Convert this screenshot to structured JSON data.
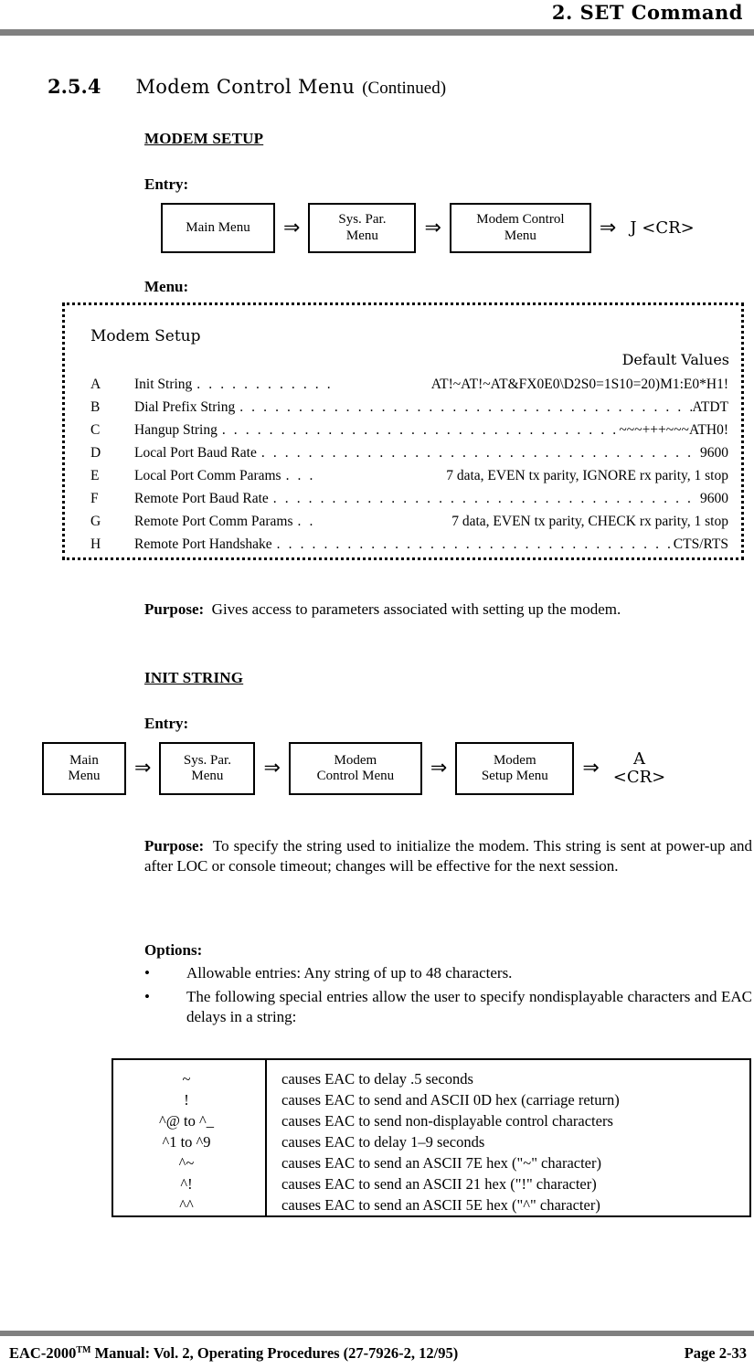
{
  "header": {
    "chapter_title": "2.  SET Command",
    "rule_color": "#808080"
  },
  "section": {
    "number": "2.5.4",
    "title": "Modem Control Menu",
    "continued": "(Continued)"
  },
  "modem_setup": {
    "heading": "MODEM SETUP",
    "entry_label": "Entry:",
    "entry_flow": {
      "boxes": [
        "Main Menu",
        "Sys. Par.\nMenu",
        "Modem Control\nMenu"
      ],
      "arrow": "⇒",
      "key": "J <CR>"
    },
    "menu_label": "Menu:",
    "screen": {
      "title": "Modem Setup",
      "defaults_header": "Default Values",
      "rows": [
        {
          "key": "A",
          "label": "Init String",
          "value": "AT!~AT!~AT&FX0E0\\D2S0=1S10=20)M1:E0*H1!"
        },
        {
          "key": "B",
          "label": "Dial Prefix String",
          "value": "ATDT"
        },
        {
          "key": "C",
          "label": "Hangup String",
          "value": "~~~+++~~~ATH0!"
        },
        {
          "key": "D",
          "label": "Local Port Baud Rate",
          "value": "9600"
        },
        {
          "key": "E",
          "label": "Local Port Comm Params",
          "value": "7 data, EVEN tx parity, IGNORE rx parity, 1 stop"
        },
        {
          "key": "F",
          "label": "Remote Port Baud Rate",
          "value": "9600"
        },
        {
          "key": "G",
          "label": "Remote Port Comm Params",
          "value": "7 data, EVEN tx parity, CHECK rx parity, 1 stop"
        },
        {
          "key": "H",
          "label": "Remote Port Handshake",
          "value": "CTS/RTS"
        }
      ]
    },
    "purpose_label": "Purpose:",
    "purpose_text": "Gives access to parameters associated with setting up the modem."
  },
  "init_string": {
    "heading": "INIT STRING",
    "entry_label": "Entry:",
    "entry_flow": {
      "boxes": [
        "Main\nMenu",
        "Sys. Par.\nMenu",
        "Modem\nControl Menu",
        "Modem\nSetup Menu"
      ],
      "arrow": "⇒",
      "key": "A\n<CR>"
    },
    "purpose_label": "Purpose:",
    "purpose_text": "To specify the string used to initialize the modem.  This string is sent at power-up and after LOC or console timeout; changes will be effective for the next session.",
    "options_label": "Options:",
    "bullet_glyph": "•",
    "options": [
      "Allowable entries:  Any string of up to 48 characters.",
      "The following special entries allow the user to specify nondisplayable characters and EAC delays in a string:"
    ]
  },
  "special_table": {
    "rows": [
      {
        "code": "~",
        "desc": "causes EAC to delay .5 seconds"
      },
      {
        "code": "!",
        "desc": "causes EAC to send and ASCII 0D hex (carriage return)"
      },
      {
        "code": "^@ to ^_",
        "desc": "causes EAC to send non-displayable control characters"
      },
      {
        "code": "^1 to ^9",
        "desc": "causes EAC to delay 1–9 seconds"
      },
      {
        "code": "^~",
        "desc": "causes EAC to send an ASCII 7E hex (\"~\" character)"
      },
      {
        "code": "^!",
        "desc": "causes EAC to send an ASCII 21 hex (\"!\" character)"
      },
      {
        "code": "^^",
        "desc": "causes EAC to send an ASCII 5E hex (\"^\" character)"
      }
    ]
  },
  "footer": {
    "manual_prefix": "EAC-2000",
    "trademark": "TM",
    "manual_rest": " Manual:  Vol. 2, Operating Procedures (27-7926-2, 12/95)",
    "page": "Page 2-33"
  }
}
